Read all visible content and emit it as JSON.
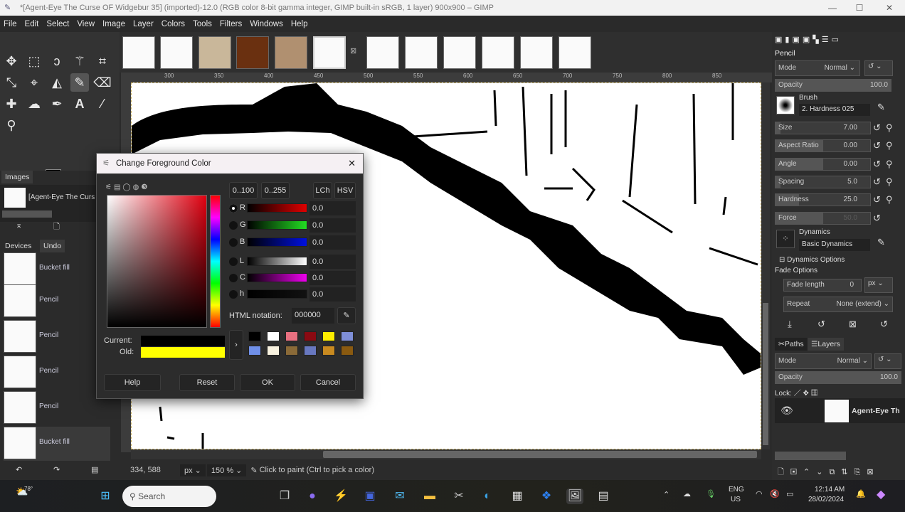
{
  "window": {
    "title": "*[Agent-Eye The Curse OF Widgebur 35] (imported)-12.0 (RGB color 8-bit gamma integer, GIMP built-in sRGB, 1 layer) 900x900 – GIMP",
    "minimize": "—",
    "maximize": "☐",
    "close": "✕"
  },
  "menu": [
    "File",
    "Edit",
    "Select",
    "View",
    "Image",
    "Layer",
    "Colors",
    "Tools",
    "Filters",
    "Windows",
    "Help"
  ],
  "ruler": [
    "300",
    "350",
    "400",
    "450",
    "500",
    "550",
    "600",
    "650",
    "700",
    "750",
    "800",
    "850"
  ],
  "images_panel": {
    "tab": "Images",
    "item": "[Agent-Eye The Curs"
  },
  "undo_panel": {
    "tabs": [
      "Devices",
      "Undo"
    ],
    "items": [
      "Bucket fill",
      "Pencil",
      "Pencil",
      "Pencil",
      "Pencil",
      "Bucket fill"
    ]
  },
  "status": {
    "coords": "334, 588",
    "unit": "px",
    "zoom": "150 %",
    "message": "Click to paint (Ctrl to pick a color)"
  },
  "tool_options": {
    "title": "Pencil",
    "mode_label": "Mode",
    "mode_value": "Normal",
    "opacity_label": "Opacity",
    "opacity": "100.0",
    "brush_label": "Brush",
    "brush": "2. Hardness 025",
    "params": [
      {
        "label": "Size",
        "value": "7.00",
        "fill": 0.05
      },
      {
        "label": "Aspect Ratio",
        "value": "0.00",
        "fill": 0.5
      },
      {
        "label": "Angle",
        "value": "0.00",
        "fill": 0.5
      },
      {
        "label": "Spacing",
        "value": "5.0",
        "fill": 0.05
      },
      {
        "label": "Hardness",
        "value": "25.0",
        "fill": 0.25
      },
      {
        "label": "Force",
        "value": "50.0",
        "fill": 0.5
      }
    ],
    "dynamics_label": "Dynamics",
    "dynamics": "Basic Dynamics",
    "dynamics_options": "Dynamics Options",
    "fade_options": "Fade Options",
    "fade_length_label": "Fade length",
    "fade_length": "0",
    "fade_unit": "px",
    "repeat_label": "Repeat",
    "repeat": "None (extend)"
  },
  "layers": {
    "tabs": [
      "Paths",
      "Layers"
    ],
    "mode_label": "Mode",
    "mode_value": "Normal",
    "opacity_label": "Opacity",
    "opacity": "100.0",
    "lock_label": "Lock:",
    "layer_name": "Agent-Eye Th"
  },
  "dialog": {
    "title": "Change Foreground Color",
    "close": "✕",
    "range_buttons": [
      "0..100",
      "0..255"
    ],
    "model_buttons": [
      "LCh",
      "HSV"
    ],
    "channels": [
      {
        "label": "R",
        "value": "0.0",
        "color": "#e00000"
      },
      {
        "label": "G",
        "value": "0.0",
        "color": "#22dd22"
      },
      {
        "label": "B",
        "value": "0.0",
        "color": "#0010e0"
      },
      {
        "label": "L",
        "value": "0.0",
        "color": "#ffffff"
      },
      {
        "label": "C",
        "value": "0.0",
        "color": "#ee00ee"
      },
      {
        "label": "h",
        "value": "0.0",
        "color": "#111111"
      }
    ],
    "html_label": "HTML notation:",
    "html_value": "000000",
    "current_label": "Current:",
    "old_label": "Old:",
    "current_color": "#000000",
    "old_color": "#ffff00",
    "history": [
      "#000000",
      "#ffffff",
      "#e87080",
      "#8a0a12",
      "#ffee00",
      "#7f8fd8",
      "#7090e8",
      "#f8f2e0",
      "#8a6a38",
      "#6878c0",
      "#c88a20",
      "#8a5a10"
    ],
    "buttons": {
      "help": "Help",
      "reset": "Reset",
      "ok": "OK",
      "cancel": "Cancel"
    }
  },
  "taskbar": {
    "weather": "78°",
    "search": "Search",
    "lang1": "ENG",
    "lang2": "US",
    "time": "12:14 AM",
    "date": "28/02/2024"
  }
}
